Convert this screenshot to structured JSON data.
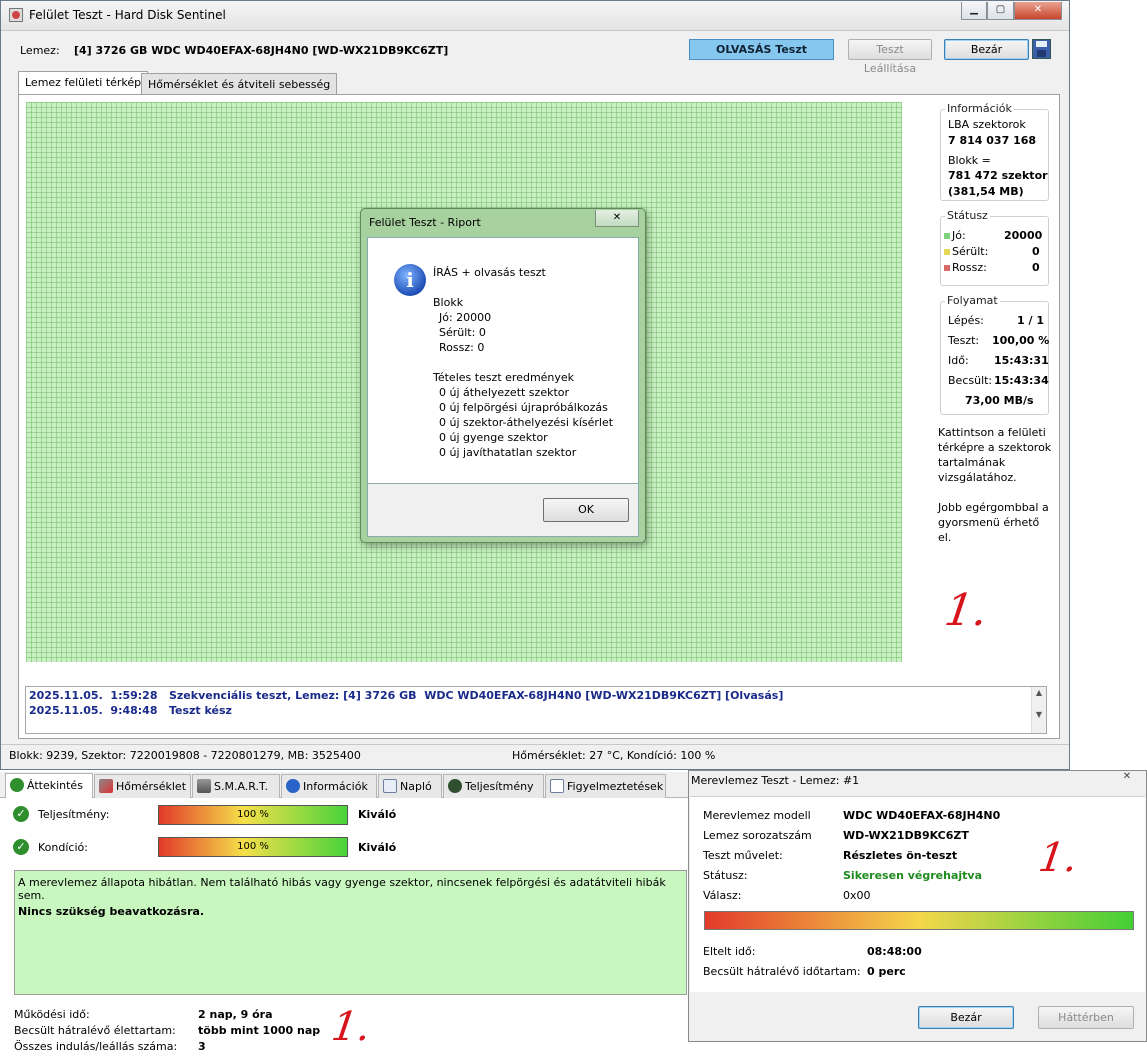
{
  "main_window": {
    "title": "Felület Teszt - Hard Disk Sentinel",
    "disk_label": "Lemez:",
    "disk_value": "[4] 3726 GB  WDC WD40EFAX-68JH4N0 [WD-WX21DB9KC6ZT]",
    "test_mode": "OLVASÁS Teszt",
    "stop_button": "Teszt Leállítása",
    "close_button": "Bezár",
    "tabs": [
      "Lemez felületi térkép",
      "Hőmérséklet és átviteli sebesség"
    ],
    "info": {
      "title": "Információk",
      "lba_label": "LBA szektorok",
      "lba_value": "7 814 037 168",
      "block_label": "Blokk =",
      "block_value": "781 472 szektor",
      "block_size": "(381,54 MB)"
    },
    "status": {
      "title": "Státusz",
      "good_label": "Jó:",
      "good_value": "20000",
      "damaged_label": "Sérült:",
      "damaged_value": "0",
      "bad_label": "Rossz:",
      "bad_value": "0",
      "colors": {
        "good": "#7fd37a",
        "damaged": "#e6d65a",
        "bad": "#d86a6a"
      }
    },
    "progress": {
      "title": "Folyamat",
      "step_label": "Lépés:",
      "step_value": "1 / 1",
      "test_label": "Teszt:",
      "test_value": "100,00 %",
      "time_label": "Idő:",
      "time_value": "15:43:31",
      "est_label": "Becsült:",
      "est_value": "15:43:34",
      "speed": "73,00 MB/s"
    },
    "hint1": "Kattintson a felületi térképre a szektorok tartalmának vizsgálatához.",
    "hint2": "Jobb egérgombbal a gyorsmenü érhető el.",
    "log": [
      "2025.11.05.  1:59:28   Szekvenciális teszt, Lemez: [4] 3726 GB  WDC WD40EFAX-68JH4N0 [WD-WX21DB9KC6ZT] [Olvasás]",
      "2025.11.05.  9:48:48   Teszt kész"
    ],
    "statusbar_left": "Blokk: 9239, Szektor: 7220019808 - 7220801279, MB: 3525400",
    "statusbar_right": "Hőmérséklet: 27  °C,  Kondíció: 100 %"
  },
  "report_dialog": {
    "title": "Felület Teszt - Riport",
    "heading": "ÍRÁS + olvasás teszt",
    "block_title": "Blokk",
    "good": "Jó: 20000",
    "damaged": "Sérült: 0",
    "bad": "Rossz: 0",
    "results_title": "Tételes teszt eredmények",
    "results": [
      "0 új áthelyezett szektor",
      "0 új felpörgési újrapróbálkozás",
      "0 új szektor-áthelyezési kísérlet",
      "0 új gyenge szektor",
      "0 új javíthatatlan szektor"
    ],
    "ok_button": "OK"
  },
  "overview": {
    "tabs": [
      "Áttekintés",
      "Hőmérséklet",
      "S.M.A.R.T.",
      "Információk",
      "Napló",
      "Teljesítmény",
      "Figyelmeztetések"
    ],
    "performance_label": "Teljesítmény:",
    "performance_value": "100 %",
    "performance_rating": "Kiváló",
    "performance_level": 1.0,
    "condition_label": "Kondíció:",
    "condition_value": "100 %",
    "condition_rating": "Kiváló",
    "condition_level": 1.0,
    "message": "A merevlemez állapota hibátlan. Nem található hibás vagy gyenge szektor, nincsenek felpörgési és adatátviteli hibák sem.",
    "message_bold": "Nincs szükség beavatkozásra.",
    "uptime_label": "Működési idő:",
    "uptime_value": "2 nap, 9 óra",
    "lifetime_label": "Becsült hátralévő élettartam:",
    "lifetime_value": "több mint 1000 nap",
    "startstop_label": "Összes indulás/leállás száma:",
    "startstop_value": "3"
  },
  "selftest_dialog": {
    "title": "Merevlemez Teszt - Lemez: #1",
    "model_label": "Merevlemez modell",
    "model_value": "WDC WD40EFAX-68JH4N0",
    "serial_label": "Lemez sorozatszám",
    "serial_value": "WD-WX21DB9KC6ZT",
    "op_label": "Teszt művelet:",
    "op_value": "Részletes ön-teszt",
    "status_label": "Státusz:",
    "status_value": "Sikeresen végrehajtva",
    "response_label": "Válasz:",
    "response_value": "0x00",
    "progress_level": 1.0,
    "elapsed_label": "Eltelt idő:",
    "elapsed_value": "08:48:00",
    "remaining_label": "Becsült hátralévő időtartam:",
    "remaining_value": "0 perc",
    "close_button": "Bezár",
    "background_button": "Háttérben"
  },
  "annotations": {
    "mark": "1."
  }
}
